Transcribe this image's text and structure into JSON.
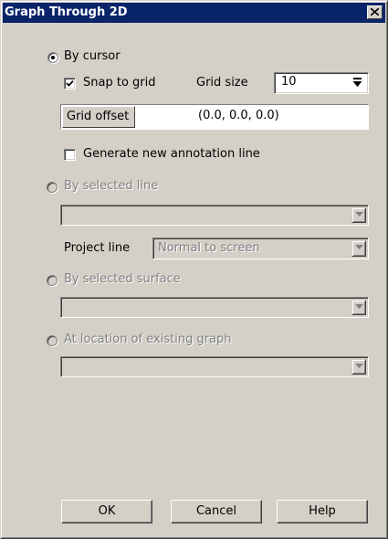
{
  "window": {
    "title": "Graph Through 2D"
  },
  "options": {
    "by_cursor": {
      "label": "By cursor",
      "selected": true
    },
    "snap_to_grid": {
      "label": "Snap to grid",
      "checked": true
    },
    "grid_size": {
      "label": "Grid size",
      "value": "10"
    },
    "grid_offset": {
      "label": "Grid offset",
      "value": "(0.0, 0.0, 0.0)"
    },
    "generate_annotation": {
      "label": "Generate new annotation line",
      "checked": false
    },
    "by_selected_line": {
      "label": "By selected line",
      "selected": false,
      "enabled": false,
      "selection": ""
    },
    "project_line": {
      "label": "Project line",
      "value": "Normal to screen",
      "enabled": false
    },
    "by_selected_surface": {
      "label": "By selected surface",
      "selected": false,
      "enabled": false,
      "selection": ""
    },
    "at_existing_graph": {
      "label": "At location of existing graph",
      "selected": false,
      "enabled": false,
      "selection": ""
    }
  },
  "buttons": {
    "ok": "OK",
    "cancel": "Cancel",
    "help": "Help"
  },
  "colors": {
    "title_bar": "#0a246a",
    "dialog_face": "#d4d0c8",
    "disabled_text": "#808080"
  }
}
